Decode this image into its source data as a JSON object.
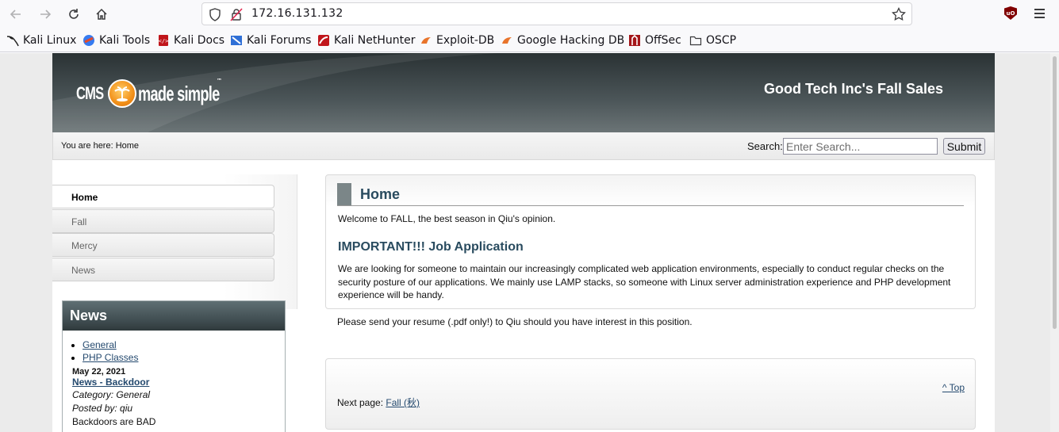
{
  "browser": {
    "url": "172.16.131.132",
    "bookmarks": [
      {
        "label": "Kali Linux"
      },
      {
        "label": "Kali Tools"
      },
      {
        "label": "Kali Docs"
      },
      {
        "label": "Kali Forums"
      },
      {
        "label": "Kali NetHunter"
      },
      {
        "label": "Exploit-DB"
      },
      {
        "label": "Google Hacking DB"
      },
      {
        "label": "OffSec"
      },
      {
        "label": "OSCP"
      }
    ]
  },
  "site": {
    "logo_text": "CMS Made Simple",
    "logo_cms": "CMS",
    "logo_rest": "made simple",
    "logo_tm": "™",
    "title": "Good Tech Inc's Fall Sales"
  },
  "breadcrumb": {
    "text": "You are here: Home"
  },
  "search": {
    "label": "Search:",
    "placeholder": "Enter Search...",
    "button": "Submit"
  },
  "nav": {
    "items": [
      {
        "label": "Home"
      },
      {
        "label": "Fall"
      },
      {
        "label": "Mercy"
      },
      {
        "label": "News"
      }
    ]
  },
  "news": {
    "heading": "News",
    "categories": [
      {
        "label": "General"
      },
      {
        "label": "PHP Classes"
      }
    ],
    "article": {
      "date": "May 22, 2021",
      "title": "News - Backdoor",
      "category": "Category: General",
      "posted_by": "Posted by: qiu",
      "summary": "Backdoors are BAD"
    }
  },
  "content": {
    "heading": "Home",
    "welcome": "Welcome to FALL, the best season in Qiu's opinion.",
    "subheading": "IMPORTANT!!! Job Application",
    "para1": "We are looking for someone to maintain our increasingly complicated web application environments, especially to conduct regular checks on the security posture of our applications. We mainly use LAMP stacks, so someone with Linux server administration experience and PHP development experience will be handy.",
    "para2": "Please send your resume (.pdf only!) to Qiu should you have interest in this position.",
    "top_link": "^ Top",
    "next_label": "Next page:",
    "next_link": "Fall (秋)"
  },
  "colors": {
    "heading": "#294b5f",
    "link": "#24496e",
    "header_dark": "#2a3234"
  }
}
